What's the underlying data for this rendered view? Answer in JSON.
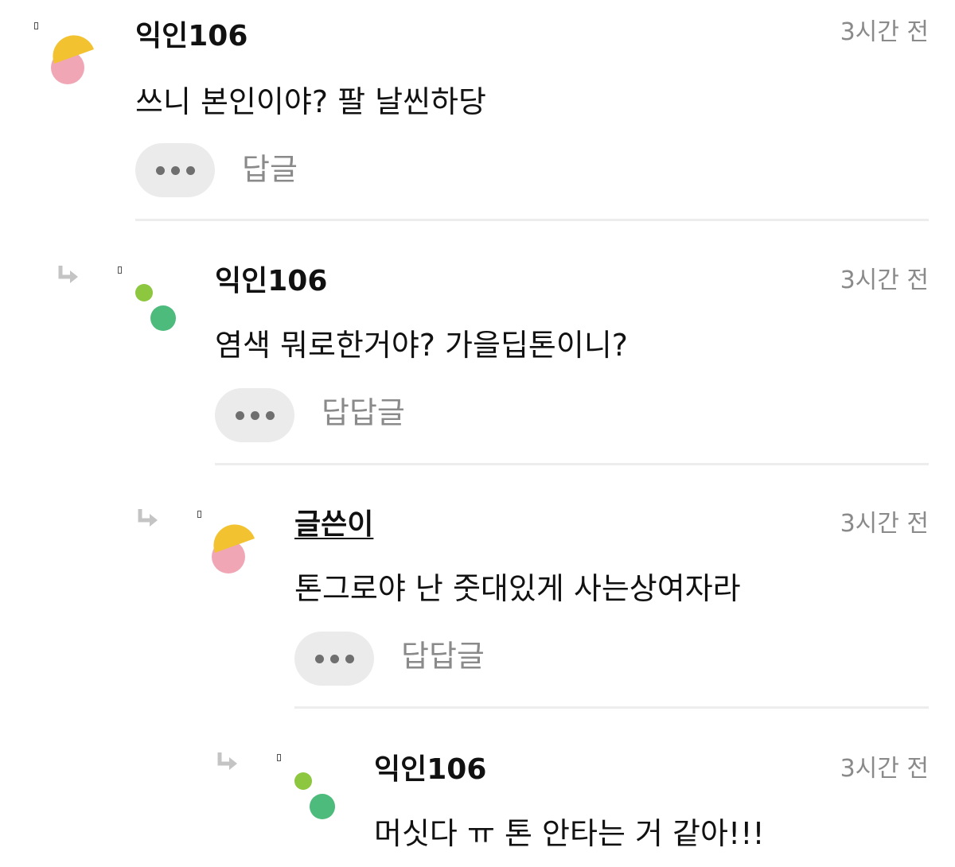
{
  "comments": [
    {
      "nickname": "익인106",
      "time": "3시간 전",
      "text": "쓰니 본인이야? 팔 날씬하당",
      "reply_label": "답글",
      "avatar": "yellow-pink-circles-icon"
    },
    {
      "nickname": "익인106",
      "time": "3시간 전",
      "text": "염색 뭐로한거야? 가을딥톤이니?",
      "reply_label": "답답글",
      "avatar": "green-dots-icon"
    },
    {
      "nickname": "글쓴이",
      "time": "3시간 전",
      "text": "톤그로야 난 줏대있게 사는상여자라",
      "reply_label": "답답글",
      "avatar": "yellow-pink-circles-icon"
    },
    {
      "nickname": "익인106",
      "time": "3시간 전",
      "text": "머싯다 ㅠ 톤 안타는 거 같아!!!",
      "reply_label": "",
      "avatar": "green-dots-icon"
    }
  ],
  "colors": {
    "avatar_yellow": "#f2c230",
    "avatar_pink": "#f0a6b4",
    "avatar_light_green": "#8dc63f",
    "avatar_dark_green": "#4dbb7c",
    "muted_text": "#8a8a8a",
    "button_bg": "#ebebeb"
  }
}
